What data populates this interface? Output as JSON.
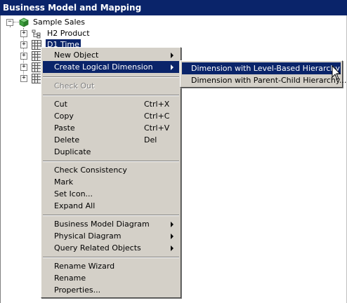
{
  "header": {
    "title": "Business Model and Mapping"
  },
  "tree": {
    "root": {
      "label": "Sample Sales"
    },
    "children": [
      {
        "label": "H2 Product"
      },
      {
        "label": "D1 Time"
      },
      {
        "label": ""
      },
      {
        "label": ""
      },
      {
        "label": ""
      }
    ]
  },
  "context_menu": {
    "items": [
      {
        "label": "New Object"
      },
      {
        "label": "Create Logical Dimension"
      },
      {
        "label": "Check Out"
      },
      {
        "label": "Cut",
        "shortcut": "Ctrl+X"
      },
      {
        "label": "Copy",
        "shortcut": "Ctrl+C"
      },
      {
        "label": "Paste",
        "shortcut": "Ctrl+V"
      },
      {
        "label": "Delete",
        "shortcut": "Del"
      },
      {
        "label": "Duplicate"
      },
      {
        "label": "Check Consistency"
      },
      {
        "label": "Mark"
      },
      {
        "label": "Set Icon..."
      },
      {
        "label": "Expand All"
      },
      {
        "label": "Business Model Diagram"
      },
      {
        "label": "Physical Diagram"
      },
      {
        "label": "Query Related Objects"
      },
      {
        "label": "Rename Wizard"
      },
      {
        "label": "Rename"
      },
      {
        "label": "Properties..."
      }
    ]
  },
  "submenu": {
    "items": [
      {
        "label": "Dimension with Level-Based Hierarchy"
      },
      {
        "label": "Dimension with Parent-Child Hierarchy..."
      }
    ]
  },
  "colors": {
    "selection": "#0a246a",
    "menu_bg": "#d4d0c8",
    "disabled": "#808080"
  }
}
